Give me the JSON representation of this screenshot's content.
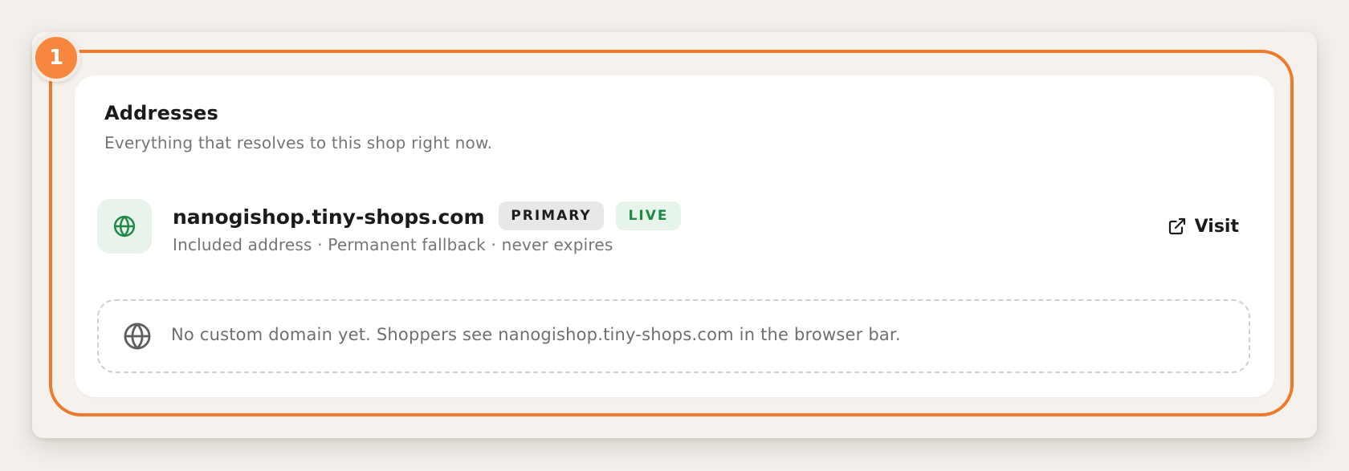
{
  "step": {
    "number": "1",
    "accent_color": "#f07a2c"
  },
  "addresses": {
    "title": "Addresses",
    "subtitle": "Everything that resolves to this shop right now.",
    "primary_address": {
      "icon": "globe-icon",
      "domain": "nanogishop.tiny-shops.com",
      "badges": {
        "primary": "PRIMARY",
        "live": "LIVE"
      },
      "meta": "Included address · Permanent fallback · never expires",
      "visit_label": "Visit",
      "visit_icon": "external-link-icon",
      "live_color": "#1f8a45"
    },
    "empty_state": {
      "icon": "globe-icon",
      "text": "No custom domain yet. Shoppers see nanogishop.tiny-shops.com in the browser bar."
    }
  }
}
